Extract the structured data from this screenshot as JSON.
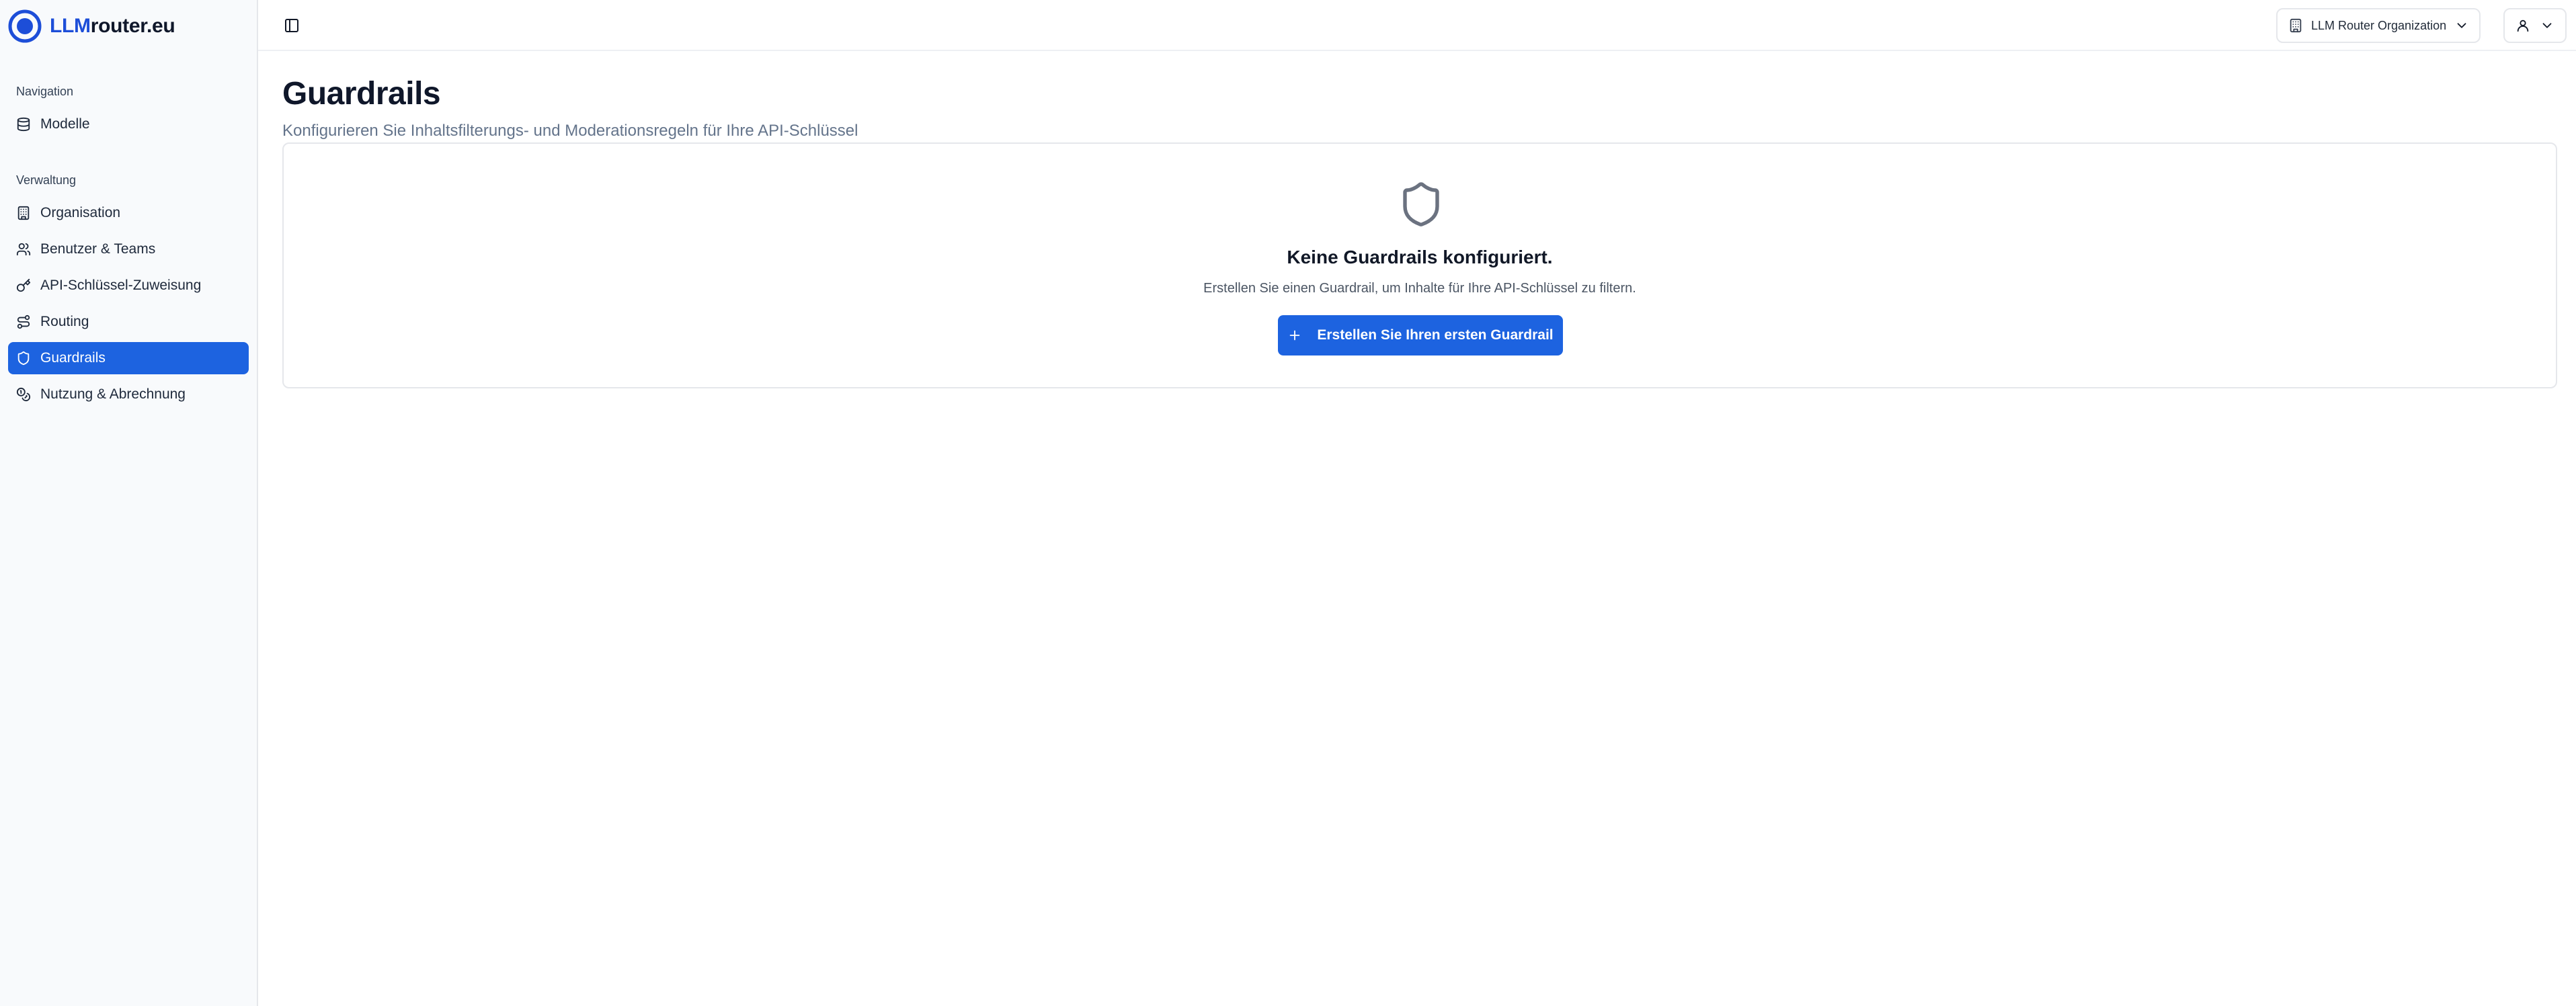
{
  "brand": {
    "name_accent": "LLM",
    "name_rest": "router.eu",
    "accent_color": "#1d4ed8"
  },
  "sidebar": {
    "sections": [
      {
        "label": "Navigation",
        "items": [
          {
            "label": "Modelle",
            "icon": "database-icon",
            "active": false
          }
        ]
      },
      {
        "label": "Verwaltung",
        "items": [
          {
            "label": "Organisation",
            "icon": "building-icon",
            "active": false
          },
          {
            "label": "Benutzer & Teams",
            "icon": "users-icon",
            "active": false
          },
          {
            "label": "API-Schlüssel-Zuweisung",
            "icon": "key-icon",
            "active": false
          },
          {
            "label": "Routing",
            "icon": "route-icon",
            "active": false
          },
          {
            "label": "Guardrails",
            "icon": "shield-icon",
            "active": true
          },
          {
            "label": "Nutzung & Abrechnung",
            "icon": "coins-icon",
            "active": false
          }
        ]
      }
    ],
    "active_color": "#1d63e0"
  },
  "header": {
    "organization": "LLM Router Organization"
  },
  "page": {
    "title": "Guardrails",
    "subtitle": "Konfigurieren Sie Inhaltsfilterungs- und Moderationsregeln für Ihre API-Schlüssel"
  },
  "empty_state": {
    "icon": "shield-icon",
    "title": "Keine Guardrails konfiguriert.",
    "description": "Erstellen Sie einen Guardrail, um Inhalte für Ihre API-Schlüssel zu filtern.",
    "button_label": "Erstellen Sie Ihren ersten Guardrail"
  }
}
